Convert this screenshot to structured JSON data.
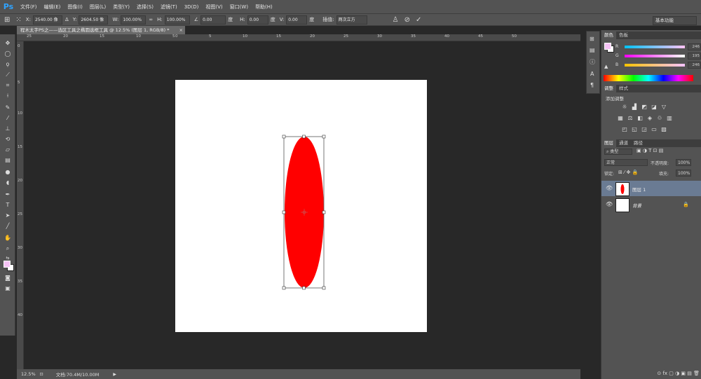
{
  "app": {
    "logo": "Ps"
  },
  "menu": [
    "文件(F)",
    "编辑(E)",
    "图像(I)",
    "图层(L)",
    "类型(Y)",
    "选择(S)",
    "滤镜(T)",
    "3D(D)",
    "视图(V)",
    "窗口(W)",
    "帮助(H)"
  ],
  "options": {
    "x_label": "X:",
    "x_value": "2540.00 像",
    "y_label": "Y:",
    "y_value": "2604.50 像",
    "w_label": "W:",
    "w_value": "100.00%",
    "h_label": "H:",
    "h_value": "100.00%",
    "angle_value": "0.00",
    "angle_unit": "度",
    "hskew_label": "H:",
    "hskew_value": "0.00",
    "hskew_unit": "度",
    "vskew_label": "V:",
    "vskew_value": "0.00",
    "vskew_unit": "度",
    "interp_label": "插值:",
    "interp_value": "两次立方",
    "workspace": "基本功能"
  },
  "document_tab": {
    "title": "程木太字PS之——选区工具之椭圆选框工具 @ 12.5% (图层 1, RGB/8) *",
    "close": "×"
  },
  "ruler_top": [
    "25",
    "20",
    "15",
    "10",
    "5",
    "0",
    "5",
    "10",
    "15",
    "20",
    "25",
    "30",
    "35",
    "40",
    "45",
    "50"
  ],
  "ruler_left": [
    "0",
    "5",
    "10",
    "15",
    "20",
    "25",
    "30",
    "35",
    "40"
  ],
  "status": {
    "zoom": "12.5%",
    "doc": "文档:70.4M/10.00M"
  },
  "color_panel": {
    "tabs": [
      "颜色",
      "色板"
    ],
    "channels": [
      {
        "label": "R",
        "value": "246"
      },
      {
        "label": "G",
        "value": "195"
      },
      {
        "label": "B",
        "value": "246"
      }
    ]
  },
  "adjust_panel": {
    "tabs": [
      "调整",
      "样式"
    ],
    "title": "添加调整"
  },
  "layers_panel": {
    "tabs": [
      "图层",
      "通道",
      "路径"
    ],
    "filter": "类型",
    "blend_mode": "正常",
    "opacity_label": "不透明度:",
    "opacity_value": "100%",
    "lock_label": "锁定:",
    "fill_label": "填充:",
    "fill_value": "100%",
    "layers": [
      {
        "name": "图层 1"
      },
      {
        "name": "背景"
      }
    ]
  },
  "colors": {
    "foreground": "#f6c3f6",
    "ellipse": "#ff0000",
    "selected_layer": "#6a7b93"
  }
}
